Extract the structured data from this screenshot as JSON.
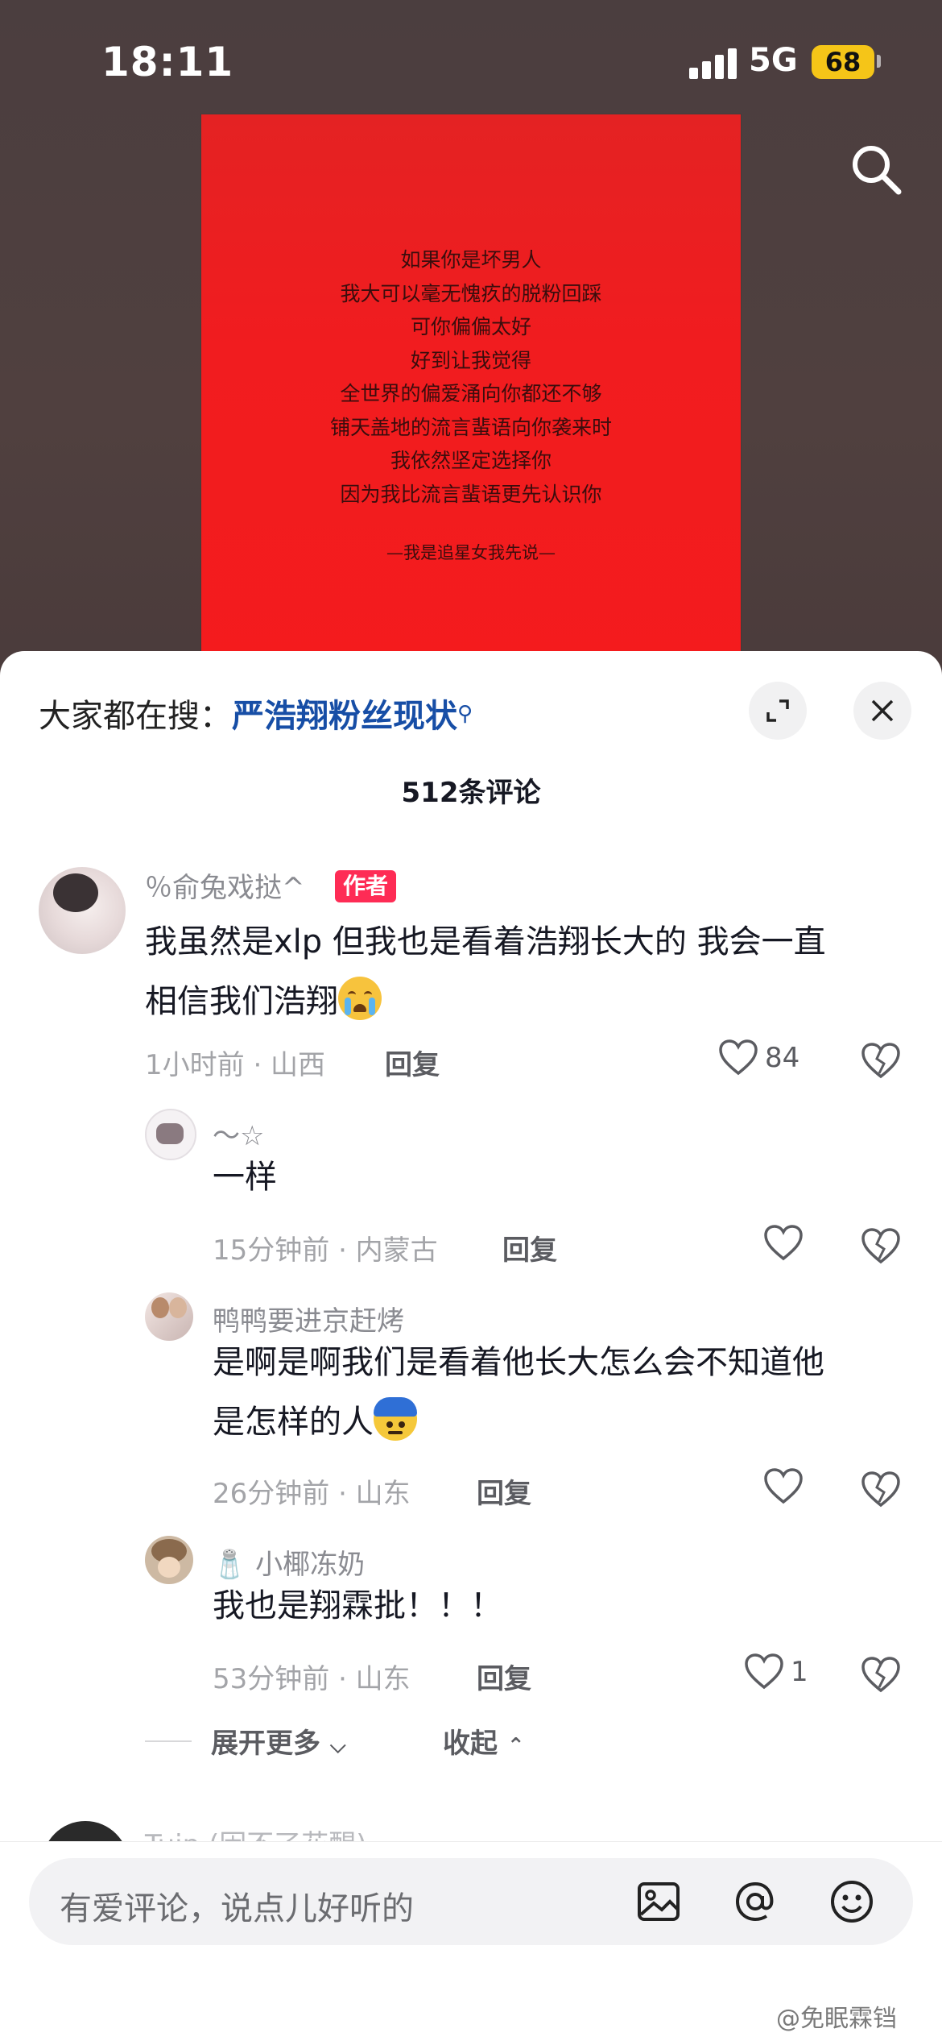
{
  "status_bar": {
    "time": "18:11",
    "network": "5G",
    "battery": "68"
  },
  "poster": {
    "poem_lines": [
      "如果你是坏男人",
      "我大可以毫无愧疚的脱粉回踩",
      "可你偏偏太好",
      "好到让我觉得",
      "全世界的偏爱涌向你都还不够",
      "铺天盖地的流言蜚语向你袭来时",
      "我依然坚定选择你",
      "因为我比流言蜚语更先认识你"
    ],
    "signature": "—我是追星女我先说—"
  },
  "sheet": {
    "hot_search_prefix": "大家都在搜：",
    "hot_search_keyword": "严浩翔粉丝现状",
    "comment_count": "512条评论"
  },
  "comments": [
    {
      "username": "％俞兔戏挞^",
      "badge": "作者",
      "text_line1": "我虽然是xlp 但我也是看着浩翔长大的 我会一直",
      "text_line2": "相信我们浩翔",
      "meta": "1小时前 · 山西",
      "reply_label": "回复",
      "likes": "84"
    }
  ],
  "replies": [
    {
      "username": "～☆",
      "text_line1": "一样",
      "meta": "15分钟前 · 内蒙古",
      "reply_label": "回复",
      "likes": ""
    },
    {
      "username": "鸭鸭要进京赶烤",
      "text_line1": "是啊是啊我们是看着他长大怎么会不知道他",
      "text_line2": "是怎样的人",
      "meta": "26分钟前 · 山东",
      "reply_label": "回复",
      "likes": ""
    },
    {
      "username": "🧂 小椰冻奶",
      "text_line1": "我也是翔霖批！！！",
      "meta": "53分钟前 · 山东",
      "reply_label": "回复",
      "likes": "1"
    }
  ],
  "thread_controls": {
    "expand": "展开更多",
    "collapse": "收起"
  },
  "next_comment": {
    "username": "Tuip (困不了花醒)"
  },
  "input": {
    "placeholder": "有爱评论，说点儿好听的"
  },
  "watermark": "@免眠霖铛",
  "icons": {
    "top": "search-icon",
    "sheet": [
      "expand-icon",
      "close-icon"
    ],
    "comment": [
      "heart-icon",
      "broken-heart-icon"
    ],
    "input": [
      "image-icon",
      "at-icon",
      "emoji-icon"
    ]
  }
}
